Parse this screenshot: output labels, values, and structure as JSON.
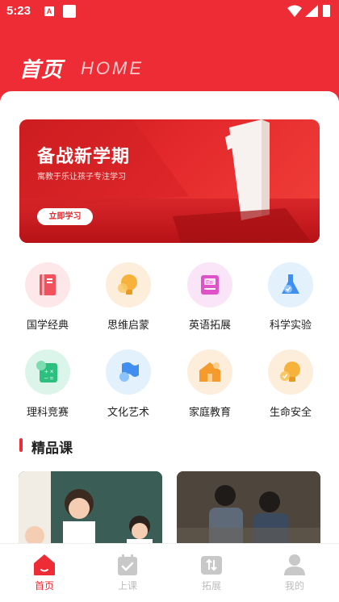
{
  "status_bar": {
    "time": "5:23",
    "notif_letter": "A"
  },
  "header": {
    "title": "首页",
    "title_en": "HOME"
  },
  "banner": {
    "title": "备战新学期",
    "subtitle": "寓教于乐让孩子专注学习",
    "button": "立即学习"
  },
  "categories": [
    {
      "label": "国学经典",
      "icon": "book-icon",
      "bg": "#fde7e8"
    },
    {
      "label": "思维启蒙",
      "icon": "lightbulb-icon",
      "bg": "#fdeedc"
    },
    {
      "label": "英语拓展",
      "icon": "english-book-icon",
      "bg": "#fae5f8"
    },
    {
      "label": "科学实验",
      "icon": "flask-icon",
      "bg": "#e3f1fd"
    },
    {
      "label": "理科竞赛",
      "icon": "math-calculator-icon",
      "bg": "#dcf5ea"
    },
    {
      "label": "文化艺术",
      "icon": "flag-icon",
      "bg": "#e3f1fd"
    },
    {
      "label": "家庭教育",
      "icon": "house-icon",
      "bg": "#fdeedc"
    },
    {
      "label": "生命安全",
      "icon": "safety-bulb-icon",
      "bg": "#fdeedc"
    }
  ],
  "section": {
    "title": "精品课"
  },
  "tabs": [
    {
      "label": "首页",
      "icon": "home-icon",
      "active": true
    },
    {
      "label": "上课",
      "icon": "calendar-check-icon",
      "active": false
    },
    {
      "label": "拓展",
      "icon": "expand-icon",
      "active": false
    },
    {
      "label": "我的",
      "icon": "user-icon",
      "active": false
    }
  ],
  "colors": {
    "brand": "#ee2c36",
    "inactive": "#c8c8c8",
    "text": "#222222"
  }
}
